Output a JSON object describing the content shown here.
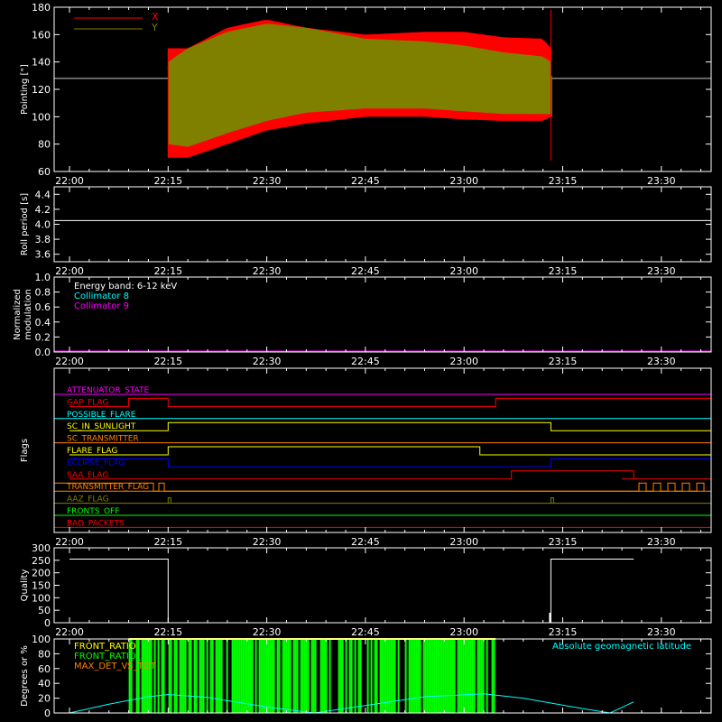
{
  "chart_data": [
    {
      "panel": "pointing",
      "type": "line",
      "ylabel": "Pointing [\"]",
      "ylim": [
        60,
        180
      ],
      "yticks": [
        "60",
        "80",
        "100",
        "120",
        "140",
        "160",
        "180"
      ],
      "xticks": [
        "22:00",
        "22:15",
        "22:30",
        "22:45",
        "23:00",
        "23:15",
        "23:30"
      ],
      "legend": [
        {
          "name": "X",
          "color": "#ff0000"
        },
        {
          "name": "Y",
          "color": "#808000"
        }
      ],
      "baseline": 128,
      "series": [
        {
          "name": "X",
          "color": "#ff0000",
          "upper": [
            [
              22.25,
              150
            ],
            [
              22.3,
              150
            ],
            [
              22.4,
              165
            ],
            [
              22.5,
              171
            ],
            [
              22.6,
              165
            ],
            [
              22.75,
              160
            ],
            [
              22.9,
              162
            ],
            [
              23.0,
              162
            ],
            [
              23.1,
              158
            ],
            [
              23.2,
              157
            ],
            [
              23.22,
              150
            ]
          ],
          "lower": [
            [
              22.25,
              70
            ],
            [
              22.3,
              70
            ],
            [
              22.4,
              80
            ],
            [
              22.5,
              90
            ],
            [
              22.6,
              95
            ],
            [
              22.75,
              100
            ],
            [
              22.9,
              100
            ],
            [
              23.0,
              98
            ],
            [
              23.1,
              97
            ],
            [
              23.2,
              97
            ],
            [
              23.22,
              100
            ]
          ]
        },
        {
          "name": "Y",
          "color": "#808000",
          "upper": [
            [
              22.25,
              140
            ],
            [
              22.3,
              150
            ],
            [
              22.4,
              162
            ],
            [
              22.5,
              168
            ],
            [
              22.6,
              165
            ],
            [
              22.75,
              157
            ],
            [
              22.9,
              155
            ],
            [
              23.0,
              152
            ],
            [
              23.1,
              147
            ],
            [
              23.2,
              144
            ],
            [
              23.22,
              140
            ]
          ],
          "lower": [
            [
              22.25,
              80
            ],
            [
              22.3,
              78
            ],
            [
              22.4,
              88
            ],
            [
              22.5,
              97
            ],
            [
              22.6,
              103
            ],
            [
              22.75,
              106
            ],
            [
              22.9,
              106
            ],
            [
              23.0,
              104
            ],
            [
              23.1,
              102
            ],
            [
              23.2,
              102
            ],
            [
              23.22,
              102
            ]
          ]
        }
      ]
    },
    {
      "panel": "roll",
      "type": "line",
      "ylabel": "Roll period [s]",
      "ylim": [
        3.5,
        4.5
      ],
      "yticks": [
        "3.6",
        "3.8",
        "4.0",
        "4.2",
        "4.4"
      ],
      "xticks": [
        "22:00",
        "22:15",
        "22:30",
        "22:45",
        "23:00",
        "23:15",
        "23:30"
      ],
      "value": 4.05
    },
    {
      "panel": "modulation",
      "type": "line",
      "ylabel": "Normalized modulation",
      "ylabel_lines": [
        "Normalized",
        "modulation"
      ],
      "ylim": [
        0,
        1
      ],
      "yticks": [
        "0.0",
        "0.2",
        "0.4",
        "0.6",
        "0.8",
        "1.0"
      ],
      "xticks": [
        "22:00",
        "22:15",
        "22:30",
        "22:45",
        "23:00",
        "23:15",
        "23:30"
      ],
      "legend": [
        {
          "name": "Energy band: 6-12 keV",
          "color": "#ffffff"
        },
        {
          "name": "Collimator 8",
          "color": "#00ffff"
        },
        {
          "name": "Collimator 9",
          "color": "#ff00ff"
        }
      ],
      "value": 0.0
    },
    {
      "panel": "flags",
      "type": "line",
      "ylabel": "Flags",
      "xticks": [
        "22:00",
        "22:15",
        "22:30",
        "22:45",
        "23:00",
        "23:15",
        "23:30"
      ],
      "flags": [
        {
          "name": "ATTENUATOR_STATE",
          "color": "#ff00ff",
          "steps": []
        },
        {
          "name": "GAP_FLAG",
          "color": "#ff0000",
          "steps": [
            [
              22.0,
              0
            ],
            [
              22.15,
              1
            ],
            [
              22.25,
              0
            ],
            [
              23.08,
              1
            ],
            [
              23.4,
              1
            ]
          ]
        },
        {
          "name": "POSSIBLE_FLARE",
          "color": "#00ffff",
          "steps": []
        },
        {
          "name": "SC_IN_SUNLIGHT",
          "color": "#ffff00",
          "steps": [
            [
              22.0,
              0
            ],
            [
              22.25,
              1
            ],
            [
              23.22,
              0
            ],
            [
              23.4,
              0
            ]
          ]
        },
        {
          "name": "SC_TRANSMITTER",
          "color": "#ff8000",
          "steps": []
        },
        {
          "name": "FLARE_FLAG",
          "color": "#ffff00",
          "steps": [
            [
              22.0,
              0
            ],
            [
              22.25,
              1
            ],
            [
              23.04,
              0
            ],
            [
              23.4,
              0
            ]
          ]
        },
        {
          "name": "ECLIPSE_FLAG",
          "color": "#0000ff",
          "steps": [
            [
              22.0,
              1
            ],
            [
              22.25,
              0
            ],
            [
              23.22,
              1
            ],
            [
              23.4,
              1
            ]
          ]
        },
        {
          "name": "SAA_FLAG",
          "color": "#ff0000",
          "steps": [
            [
              22.0,
              0
            ],
            [
              23.12,
              1
            ],
            [
              23.43,
              0
            ],
            [
              23.4,
              0
            ]
          ]
        },
        {
          "name": "TRANSMITTER_FLAG",
          "color": "#ff8000",
          "steps": []
        },
        {
          "name": "AAZ_FLAG",
          "color": "#808000",
          "steps": []
        },
        {
          "name": "FRONTS_OFF",
          "color": "#00ff00",
          "steps": []
        },
        {
          "name": "BAD_PACKETS",
          "color": "#ff0000",
          "steps": []
        }
      ]
    },
    {
      "panel": "quality",
      "type": "line",
      "ylabel": "Quality",
      "ylim": [
        0,
        300
      ],
      "yticks": [
        "0",
        "50",
        "100",
        "150",
        "200",
        "250",
        "300"
      ],
      "xticks": [
        "22:00",
        "22:15",
        "22:30",
        "22:45",
        "23:00",
        "23:15",
        "23:30"
      ],
      "segments": [
        [
          22.0,
          22.25,
          255
        ],
        [
          22.25,
          23.22,
          0
        ],
        [
          23.22,
          23.43,
          255
        ]
      ]
    },
    {
      "panel": "geo",
      "type": "line",
      "ylabel": "Degrees or %",
      "ylim": [
        0,
        100
      ],
      "yticks": [
        "0",
        "20",
        "40",
        "60",
        "80",
        "100"
      ],
      "xticks": [
        "22:00",
        "22:15",
        "22:30",
        "22:45",
        "23:00",
        "23:15",
        "23:30"
      ],
      "legend_left": [
        {
          "name": "FRONT_RATIO",
          "color": "#ffff00"
        },
        {
          "name": "FRONT_RATIO_",
          "color": "#00ff00"
        },
        {
          "name": "MAX_DET_VS_TOT",
          "color": "#ff8000"
        }
      ],
      "legend_right": {
        "name": "Absolute geomagnetic latitude",
        "color": "#00ffff"
      },
      "geomag": [
        [
          22.0,
          0
        ],
        [
          22.1,
          12
        ],
        [
          22.2,
          22
        ],
        [
          22.25,
          25
        ],
        [
          22.35,
          21
        ],
        [
          22.5,
          8
        ],
        [
          22.62,
          0
        ],
        [
          22.75,
          10
        ],
        [
          22.9,
          22
        ],
        [
          23.05,
          26
        ],
        [
          23.15,
          20
        ],
        [
          23.3,
          6
        ],
        [
          23.37,
          0
        ],
        [
          23.43,
          15
        ]
      ],
      "green_range": [
        22.15,
        23.08
      ]
    }
  ]
}
